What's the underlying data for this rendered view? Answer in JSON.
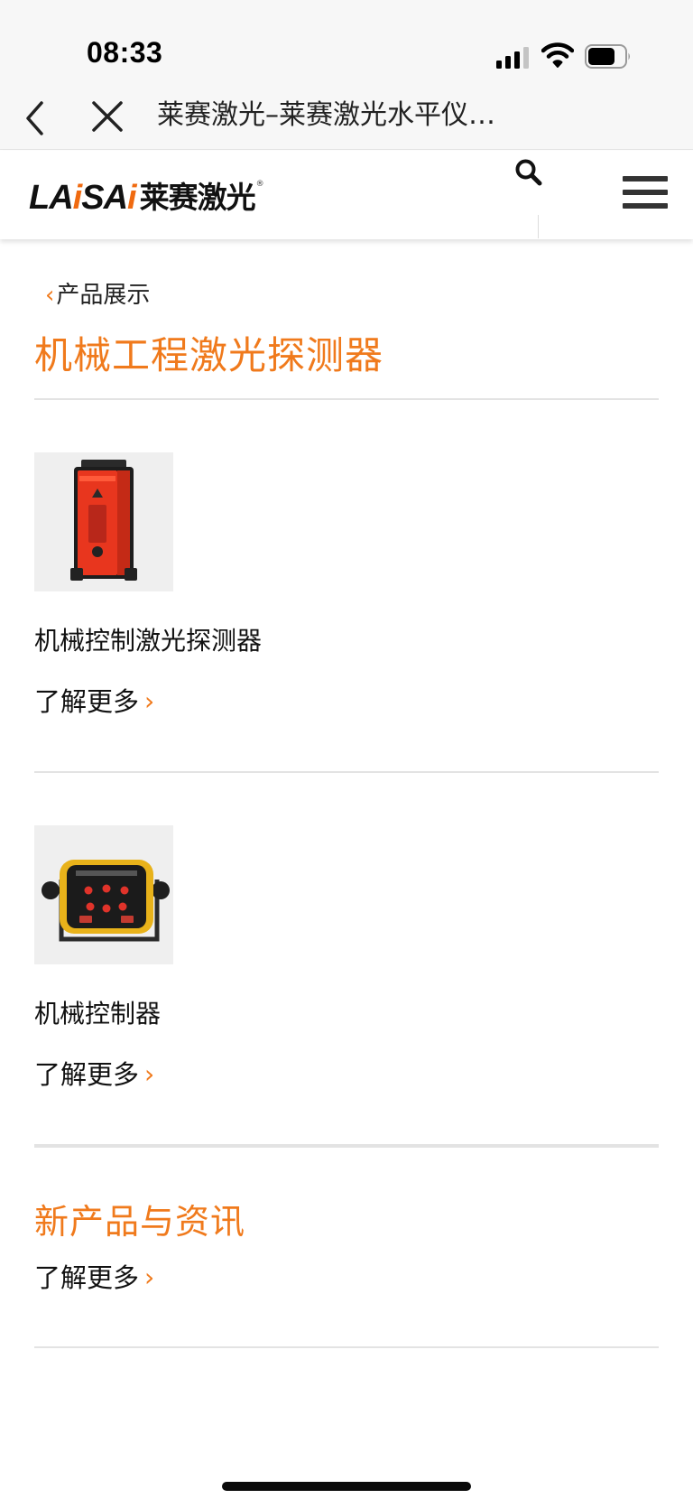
{
  "status": {
    "time": "08:33"
  },
  "browser": {
    "title": "莱赛激光–莱赛激光水平仪…"
  },
  "site": {
    "logo_latin_a": "LA",
    "logo_latin_b": "SA",
    "logo_cn": "莱赛激光",
    "logo_reg": "®"
  },
  "breadcrumb": {
    "parent": "产品展示"
  },
  "page": {
    "title": "机械工程激光探测器"
  },
  "products": [
    {
      "name": "机械控制激光探测器",
      "more": "了解更多"
    },
    {
      "name": "机械控制器",
      "more": "了解更多"
    }
  ],
  "news": {
    "title": "新产品与资讯",
    "more": "了解更多"
  },
  "colors": {
    "accent": "#f07a1c",
    "text": "#111111",
    "divider": "#e3e3e3"
  },
  "icons": {
    "back": "chevron-left-icon",
    "close": "close-icon",
    "search": "search-icon",
    "menu": "hamburger-menu-icon",
    "signal": "cellular-signal-icon",
    "wifi": "wifi-icon",
    "battery": "battery-icon",
    "more_arrow": "chevron-right-icon"
  }
}
